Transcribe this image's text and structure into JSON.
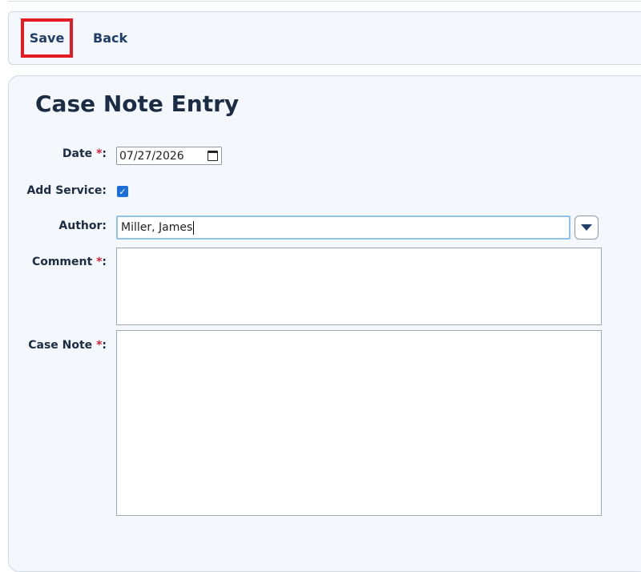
{
  "toolbar": {
    "save_label": "Save",
    "back_label": "Back"
  },
  "form": {
    "title": "Case Note Entry",
    "date_label": "Date",
    "date_value": "07/27/2026",
    "add_service_label": "Add Service:",
    "add_service_checked": true,
    "author_label": "Author:",
    "author_value": "Miller, James",
    "comment_label": "Comment",
    "case_note_label": "Case Note",
    "required_marker": "*",
    "colon": ":"
  },
  "colors": {
    "accent": "#1a6fd6",
    "label": "#1b2d45",
    "required": "#d4203a",
    "highlight": "#e31b23"
  }
}
